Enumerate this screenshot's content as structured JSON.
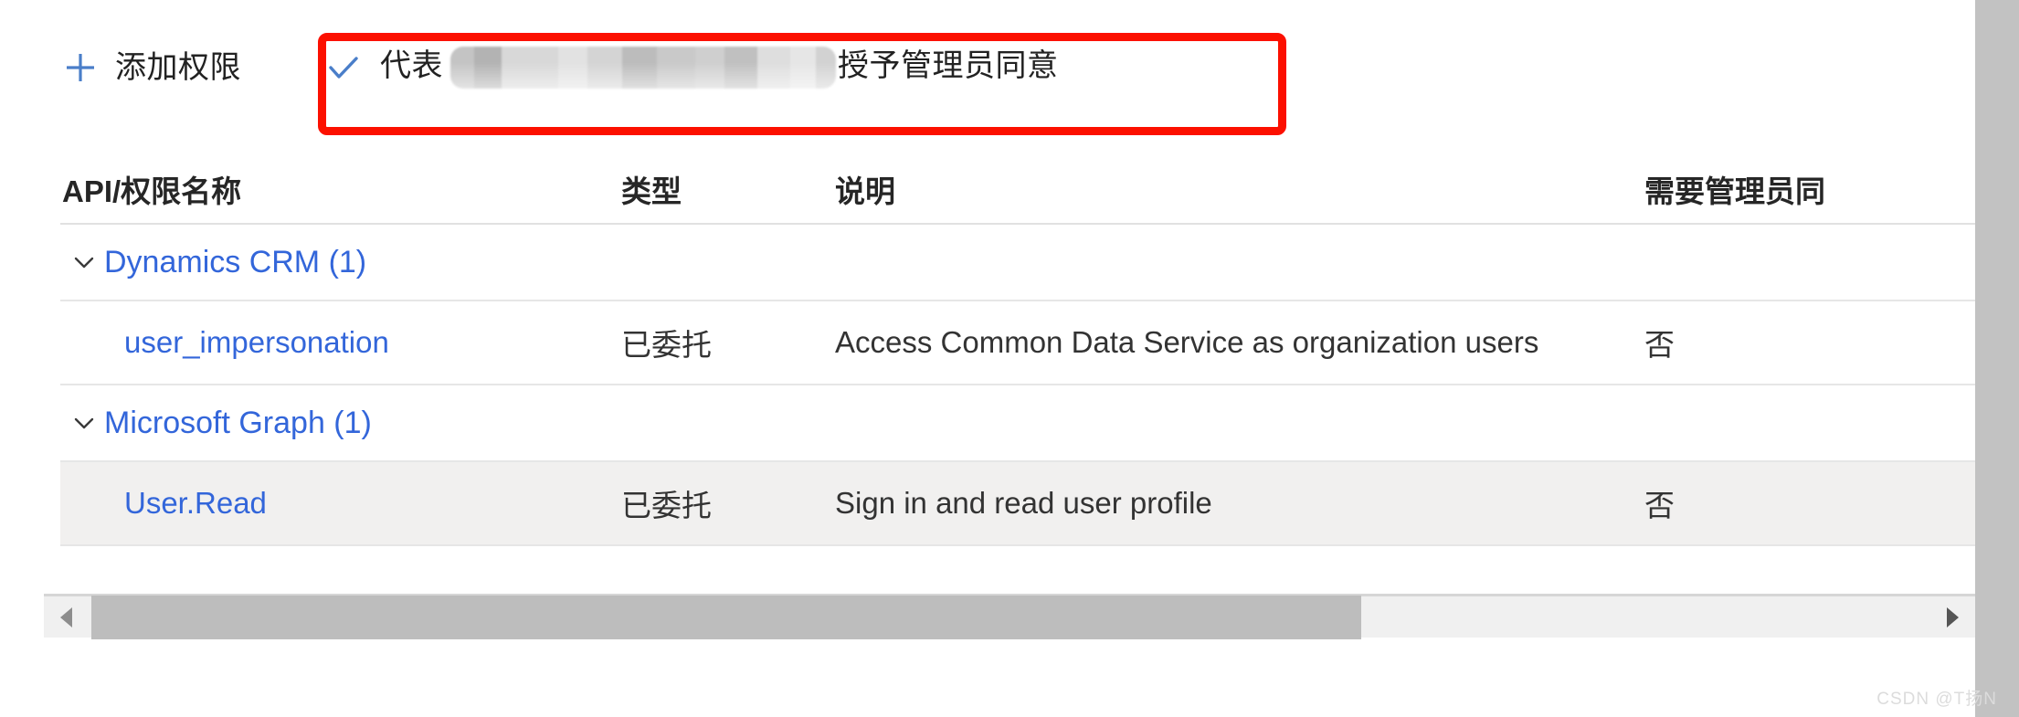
{
  "commandbar": {
    "add_permission": {
      "label": "添加权限",
      "icon": "plus-icon"
    },
    "grant_consent": {
      "label_prefix": "代表",
      "label_suffix": "授予管理员同意",
      "icon": "checkmark-icon",
      "redacted": true
    },
    "accent_color": "#4a7ec9",
    "annotation_color": "#fc1000"
  },
  "table": {
    "headers": {
      "name": "API/权限名称",
      "type": "类型",
      "description": "说明",
      "admin_consent": "需要管理员同"
    },
    "groups": [
      {
        "title": "Dynamics CRM (1)",
        "expanded": true,
        "chevron": "chevron-down-icon",
        "permissions": [
          {
            "name": "user_impersonation",
            "type": "已委托",
            "description": "Access Common Data Service as organization users",
            "admin_consent": "否",
            "selected": false
          }
        ]
      },
      {
        "title": "Microsoft Graph (1)",
        "expanded": true,
        "chevron": "chevron-down-icon",
        "permissions": [
          {
            "name": "User.Read",
            "type": "已委托",
            "description": "Sign in and read user profile",
            "admin_consent": "否",
            "selected": true
          }
        ]
      }
    ],
    "link_color": "#3366da"
  },
  "scrollbar": {
    "left_arrow": "caret-left-icon",
    "right_arrow": "caret-right-icon",
    "orientation": "horizontal"
  },
  "watermark": {
    "text": "CSDN @T扬N"
  }
}
